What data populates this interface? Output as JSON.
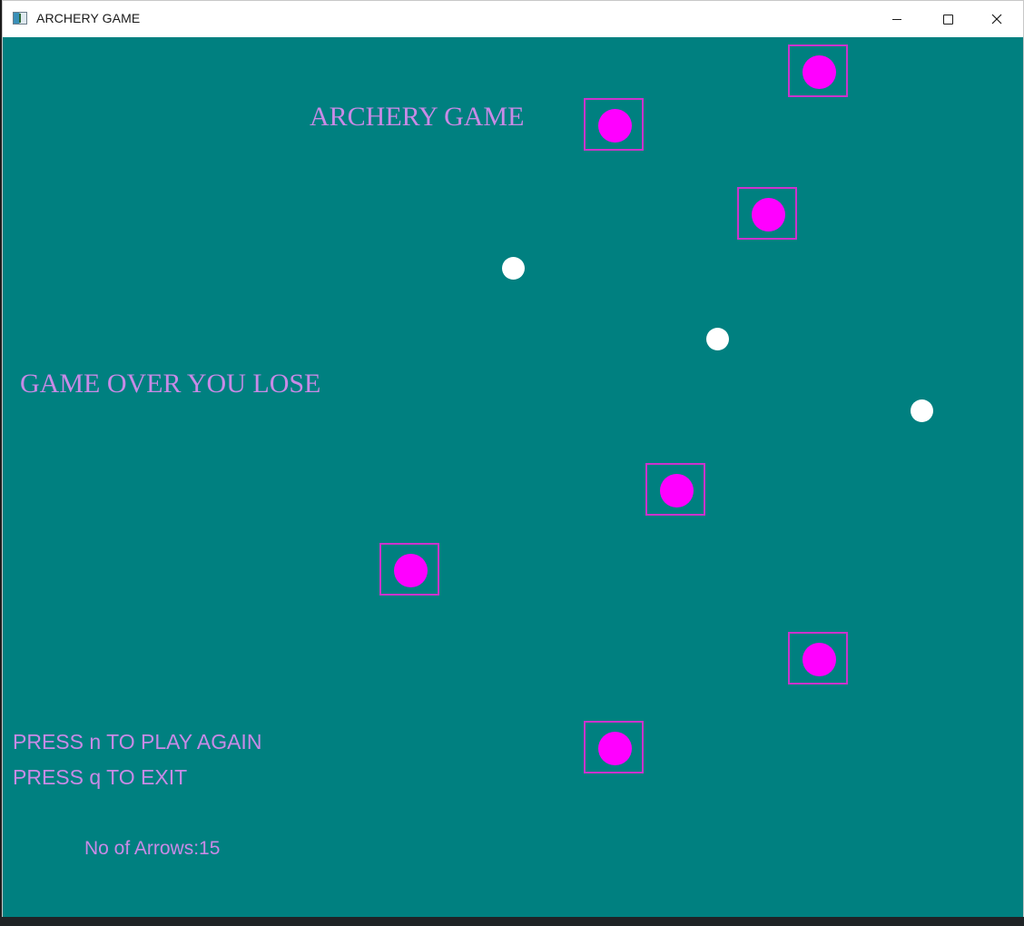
{
  "window": {
    "title": "ARCHERY GAME",
    "controls": {
      "minimize": "minimize-icon",
      "maximize": "maximize-icon",
      "close": "close-icon"
    }
  },
  "game": {
    "background_color": "#008080",
    "text_color": "#c88ae6",
    "target_color": "#ff00ff",
    "arrow_color": "#ffffff",
    "heading": "ARCHERY GAME",
    "status": "GAME OVER YOU LOSE",
    "play_again_prompt": "PRESS n TO PLAY AGAIN",
    "exit_prompt": "PRESS q TO EXIT",
    "arrows_label": "No of Arrows:",
    "arrows_count": "15",
    "targets_visible": 7,
    "arrows_in_flight": 3
  }
}
